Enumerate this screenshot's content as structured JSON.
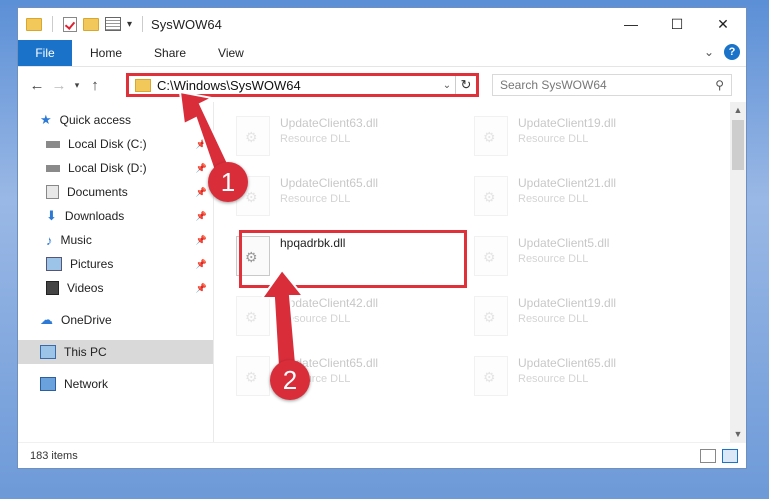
{
  "window": {
    "title": "SysWOW64",
    "minimize_glyph": "—",
    "maximize_glyph": "☐",
    "close_glyph": "✕"
  },
  "ribbon": {
    "tabs": [
      "File",
      "Home",
      "Share",
      "View"
    ],
    "expand_glyph": "⌄",
    "help_glyph": "?"
  },
  "address": {
    "path": "C:\\Windows\\SysWOW64",
    "search_placeholder": "Search SysWOW64"
  },
  "nav": {
    "items": [
      {
        "label": "Quick access",
        "icon": "star-icon",
        "level": "top",
        "pinned": false
      },
      {
        "label": "Local Disk (C:)",
        "icon": "drive-icon",
        "level": "sub",
        "pinned": true
      },
      {
        "label": "Local Disk (D:)",
        "icon": "drive-icon",
        "level": "sub",
        "pinned": true
      },
      {
        "label": "Documents",
        "icon": "documents-icon",
        "level": "sub",
        "pinned": true
      },
      {
        "label": "Downloads",
        "icon": "download-icon",
        "level": "sub",
        "pinned": true
      },
      {
        "label": "Music",
        "icon": "music-icon",
        "level": "sub",
        "pinned": true
      },
      {
        "label": "Pictures",
        "icon": "pictures-icon",
        "level": "sub",
        "pinned": true
      },
      {
        "label": "Videos",
        "icon": "video-icon",
        "level": "sub",
        "pinned": true
      },
      {
        "label": "OneDrive",
        "icon": "cloud-icon",
        "level": "top",
        "pinned": false
      },
      {
        "label": "This PC",
        "icon": "computer-icon",
        "level": "top",
        "pinned": false,
        "selected": true
      },
      {
        "label": "Network",
        "icon": "network-icon",
        "level": "top",
        "pinned": false
      }
    ]
  },
  "files": [
    {
      "name": "UpdateClient63.dll",
      "desc": "Resource DLL",
      "faded": true
    },
    {
      "name": "UpdateClient19.dll",
      "desc": "Resource DLL",
      "faded": true
    },
    {
      "name": "UpdateClient65.dll",
      "desc": "Resource DLL",
      "faded": true
    },
    {
      "name": "UpdateClient21.dll",
      "desc": "Resource DLL",
      "faded": true
    },
    {
      "name": "hpqadrbk.dll",
      "desc": "",
      "faded": false
    },
    {
      "name": "UpdateClient5.dll",
      "desc": "Resource DLL",
      "faded": true
    },
    {
      "name": "UpdateClient42.dll",
      "desc": "Resource DLL",
      "faded": true
    },
    {
      "name": "UpdateClient19.dll",
      "desc": "Resource DLL",
      "faded": true
    },
    {
      "name": "UpdateClient65.dll",
      "desc": "Resource DLL",
      "faded": true
    },
    {
      "name": "UpdateClient65.dll",
      "desc": "Resource DLL",
      "faded": true
    }
  ],
  "status": {
    "item_count": "183 items"
  },
  "annotations": {
    "step1": "1",
    "step2": "2",
    "color": "#d92d3a"
  }
}
